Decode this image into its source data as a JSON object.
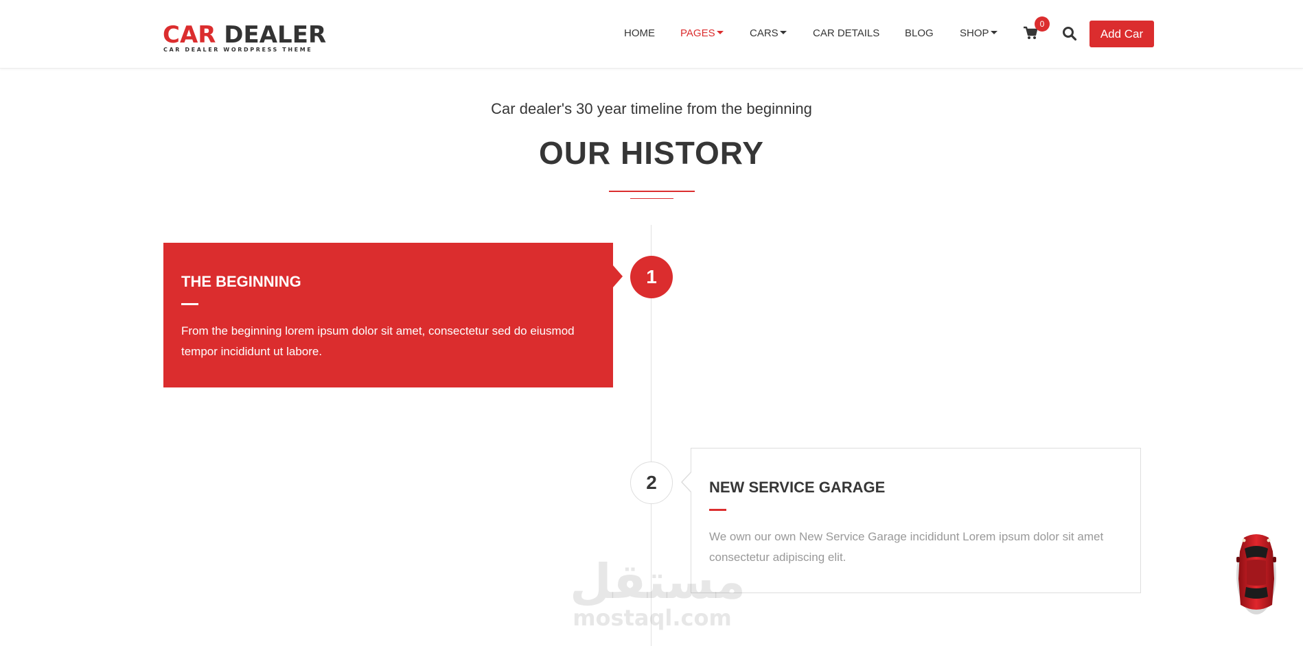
{
  "header": {
    "logo": {
      "text_red": "CAR",
      "text_dark": "DEALER",
      "tagline": "CAR DEALER WORDPRESS THEME"
    },
    "nav": [
      {
        "label": "HOME",
        "has_caret": false,
        "active": false
      },
      {
        "label": "PAGES",
        "has_caret": true,
        "active": true
      },
      {
        "label": "CARS",
        "has_caret": true,
        "active": false
      },
      {
        "label": "CAR DETAILS",
        "has_caret": false,
        "active": false
      },
      {
        "label": "BLOG",
        "has_caret": false,
        "active": false
      },
      {
        "label": "SHOP",
        "has_caret": true,
        "active": false
      }
    ],
    "cart_count": "0",
    "cart_icon": "shopping-cart-icon",
    "search_icon": "search-icon",
    "add_car_label": "Add Car"
  },
  "section": {
    "subtitle": "Car dealer's 30 year timeline from the beginning",
    "title": "OUR HISTORY"
  },
  "timeline": [
    {
      "number": "1",
      "title": "THE BEGINNING",
      "text": "From the beginning lorem ipsum dolor sit amet, consectetur sed do eiusmod tempor incididunt ut labore."
    },
    {
      "number": "2",
      "title": "NEW SERVICE GARAGE",
      "text": "We own our own New Service Garage incididunt Lorem ipsum dolor sit amet consectetur adipiscing elit."
    }
  ],
  "watermark": {
    "arabic": "مستقل",
    "latin": "mostaql.com"
  },
  "scroll_top_icon": "car-top-view-icon",
  "colors": {
    "accent": "#db2d2e",
    "text_dark": "#363636",
    "text_muted": "#999999",
    "border": "#dddddd"
  }
}
